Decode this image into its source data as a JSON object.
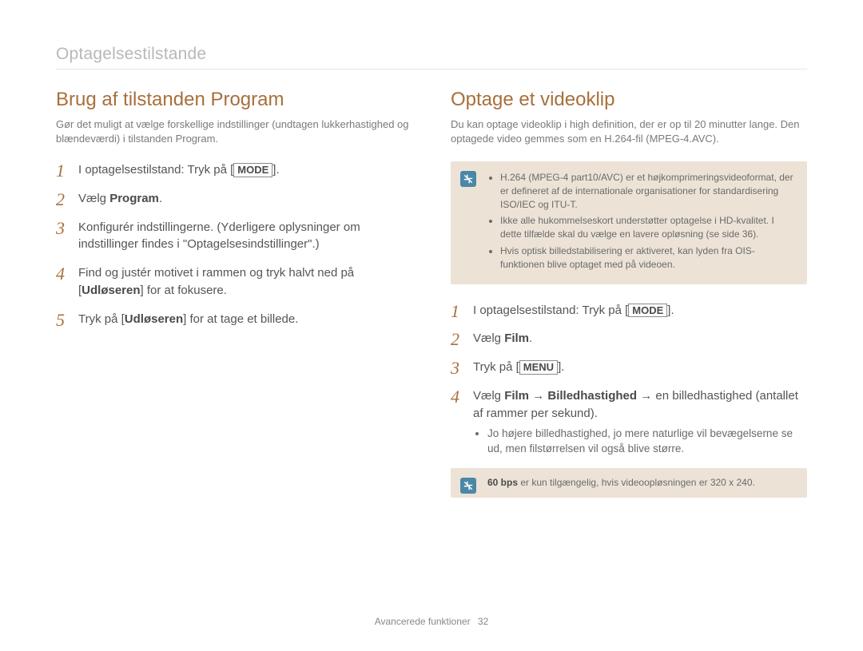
{
  "header": "Optagelsestilstande",
  "left": {
    "title": "Brug af tilstanden Program",
    "intro": "Gør det muligt at vælge forskellige indstillinger (undtagen lukkerhastighed og blændeværdi) i tilstanden Program.",
    "steps": {
      "s1_pre": "I optagelsestilstand: Tryk på [",
      "s1_btn": "MODE",
      "s1_post": "].",
      "s2_pre": "Vælg ",
      "s2_bold": "Program",
      "s2_post": ".",
      "s3": "Konfigurér indstillingerne. (Yderligere oplysninger om indstillinger findes i \"Optagelsesindstillinger\".)",
      "s4_pre": "Find og justér motivet i rammen og tryk halvt ned på [",
      "s4_bold": "Udløseren",
      "s4_post": "] for at fokusere.",
      "s5_pre": "Tryk på [",
      "s5_bold": "Udløseren",
      "s5_post": "] for at tage et billede."
    }
  },
  "right": {
    "title": "Optage et videoklip",
    "intro": "Du kan optage videoklip i high definition, der er op til 20 minutter lange. Den optagede video gemmes som en H.264-fil (MPEG-4.AVC).",
    "note1": {
      "b1": "H.264 (MPEG-4 part10/AVC) er et højkomprimeringsvideoformat, der er defineret af de internationale organisationer for standardisering ISO/IEC og ITU-T.",
      "b2": "Ikke alle hukommelseskort understøtter optagelse i HD-kvalitet. I dette tilfælde skal du vælge en lavere opløsning (se side 36).",
      "b3": "Hvis optisk billedstabilisering er aktiveret, kan lyden fra OIS-funktionen blive optaget med på videoen."
    },
    "steps": {
      "s1_pre": "I optagelsestilstand: Tryk på [",
      "s1_btn": "MODE",
      "s1_post": "].",
      "s2_pre": "Vælg ",
      "s2_bold": "Film",
      "s2_post": ".",
      "s3_pre": "Tryk på [",
      "s3_btn": "MENU",
      "s3_post": "].",
      "s4_pre": "Vælg ",
      "s4_bold1": "Film",
      "s4_arrow": " → ",
      "s4_bold2": "Billedhastighed",
      "s4_mid": " → en billedhastighed (antallet af rammer per sekund).",
      "s4_sub": "Jo højere billedhastighed, jo mere naturlige vil bevægelserne se ud, men filstørrelsen vil også blive større."
    },
    "note2_bold": "60 bps",
    "note2_rest": " er kun tilgængelig, hvis videoopløsningen er 320 x 240."
  },
  "footer": {
    "section": "Avancerede funktioner",
    "page": "32"
  }
}
